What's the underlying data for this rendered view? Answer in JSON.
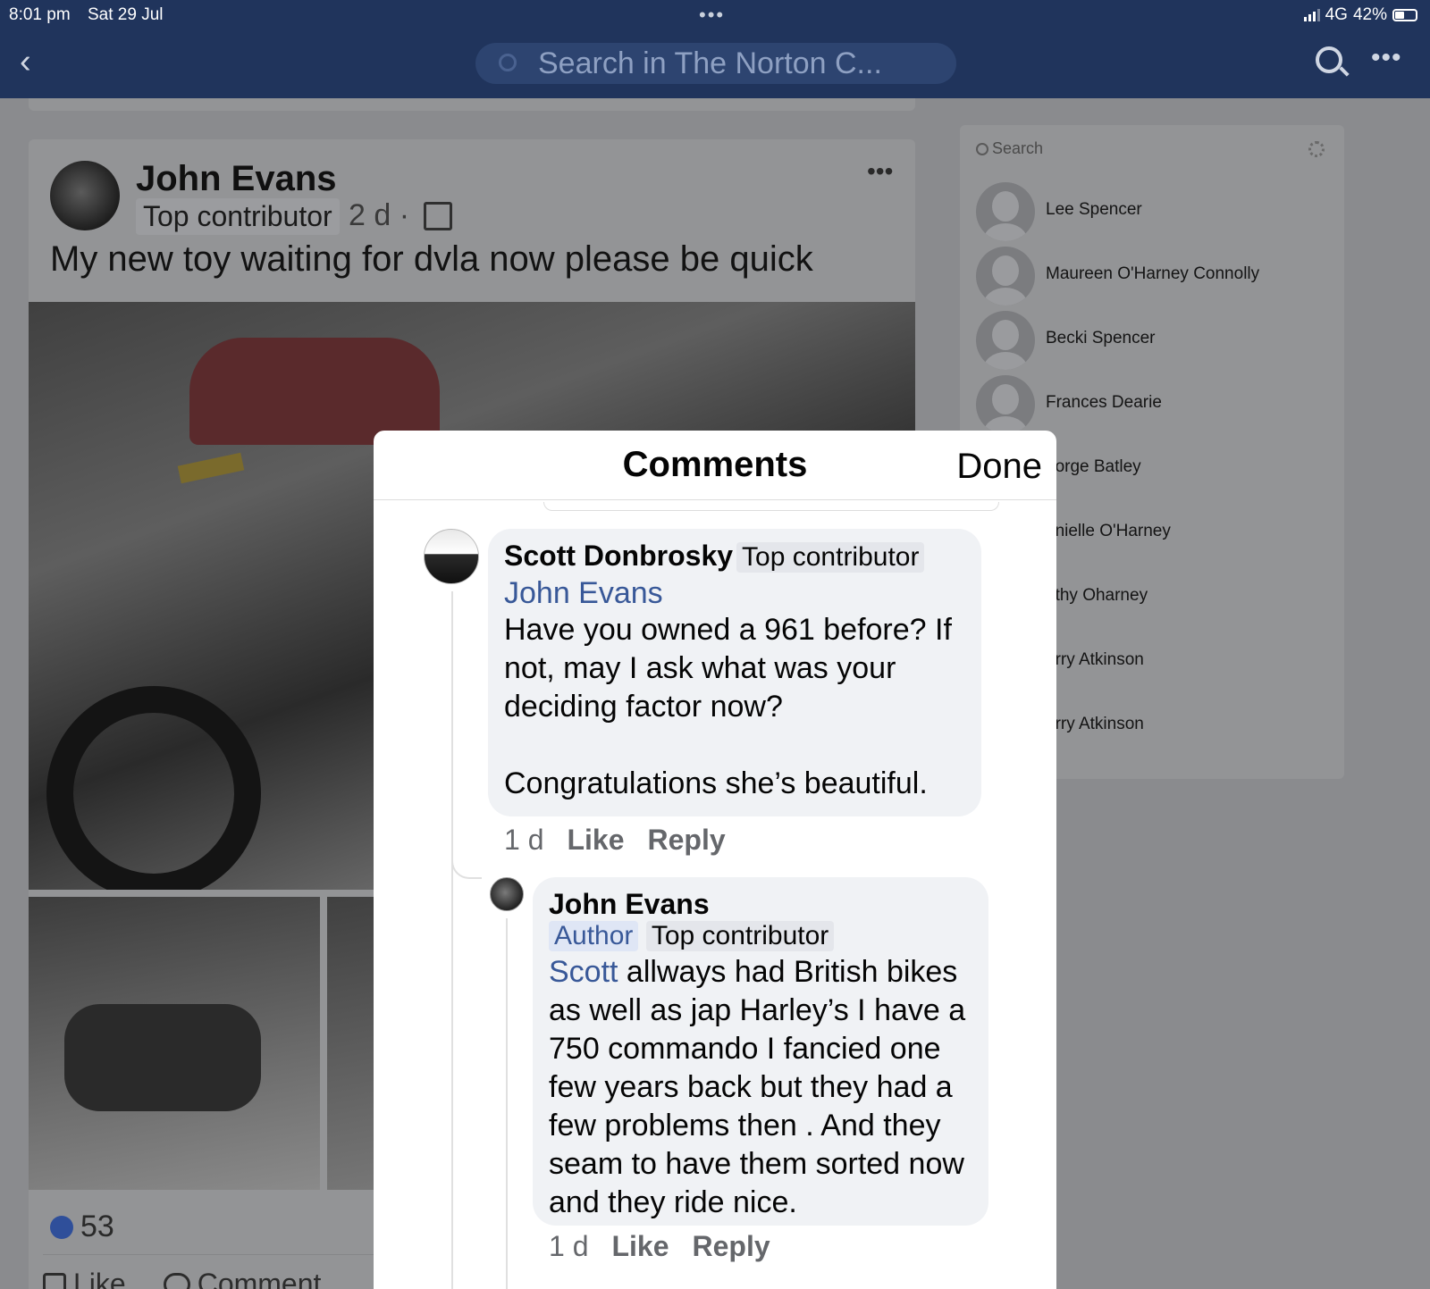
{
  "status_bar": {
    "time": "8:01 pm",
    "date": "Sat 29 Jul",
    "network": "4G",
    "battery": "42%"
  },
  "nav": {
    "search_placeholder": "Search in The Norton C..."
  },
  "post": {
    "author": "John Evans",
    "badge": "Top contributor",
    "time": "2 d ·",
    "text": "My new toy waiting for dvla now please be quick",
    "likes_count": "53",
    "like_label": "Like",
    "comment_label": "Comment"
  },
  "members": {
    "search_placeholder": "Search",
    "list": [
      "Lee Spencer",
      "Maureen O'Harney Connolly",
      "Becki Spencer",
      "Frances Dearie",
      "eorge Batley",
      "anielle O'Harney",
      "athy Oharney",
      "arry Atkinson",
      "erry Atkinson"
    ]
  },
  "modal": {
    "title": "Comments",
    "done_label": "Done",
    "comments": [
      {
        "author": "Scott Donbrosky",
        "tag": "Top contributor",
        "mention": "John Evans",
        "body_1": "Have you owned a 961 before?  If not, may I ask what was your deciding factor now?",
        "body_2": "Congratulations she’s beautiful.",
        "time": "1 d",
        "like": "Like",
        "reply": "Reply"
      },
      {
        "author": "John Evans",
        "author_tag": "Author",
        "tag": "Top contributor",
        "mention": "Scott",
        "body": " allways had British bikes as well as jap Harley’s  I have a 750 commando I fancied one few years back but they had a few problems then . And they seam to have them sorted now and they ride nice.",
        "time": "1 d",
        "like": "Like",
        "reply": "Reply"
      }
    ]
  }
}
